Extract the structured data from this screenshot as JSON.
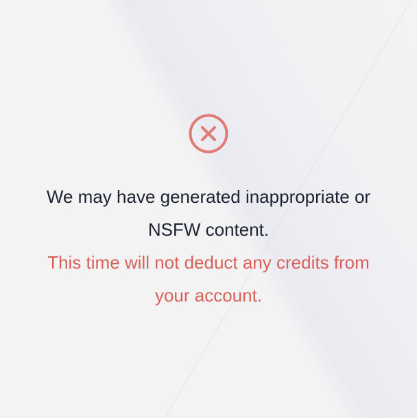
{
  "dialog": {
    "icon": "error-circle-x-icon",
    "message_line1": "We may have generated inappropriate or",
    "message_line2": "NSFW content.",
    "notice_line1": "This time will not deduct any credits from",
    "notice_line2": "your account."
  },
  "colors": {
    "background": "#f3f3f4",
    "message": "#1d2333",
    "notice": "#d9605a",
    "icon": "#e07a74"
  }
}
